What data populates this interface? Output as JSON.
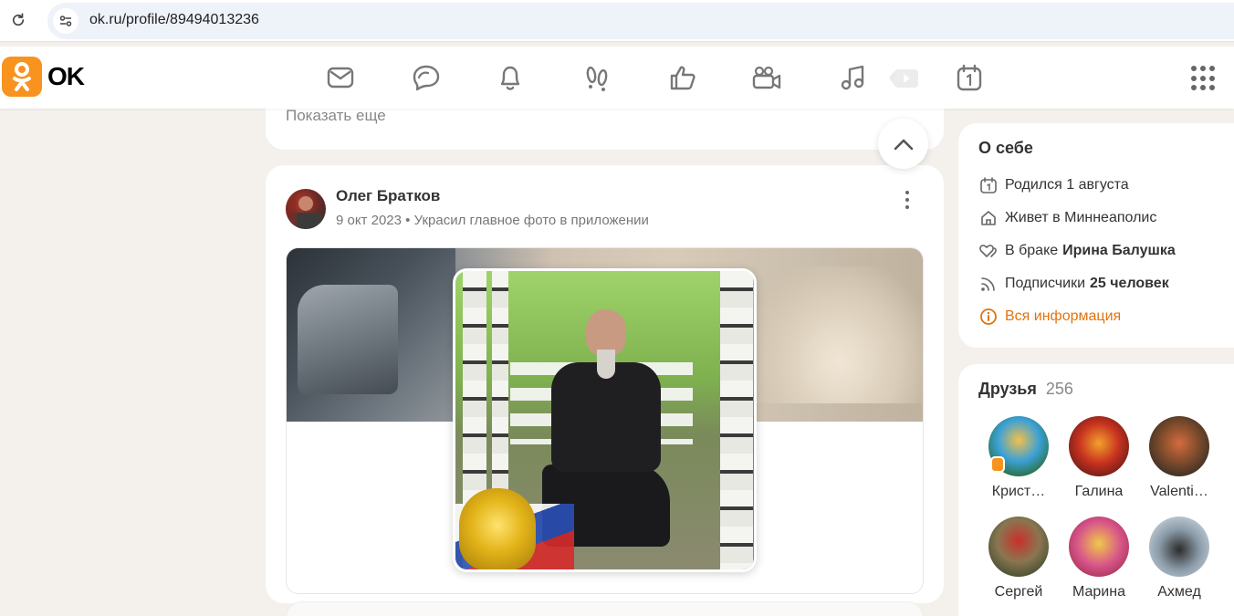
{
  "browser": {
    "url": "ok.ru/profile/89494013236",
    "icons": [
      "reload-icon",
      "site-info-icon"
    ]
  },
  "header": {
    "logo_text": "OK",
    "brand_color": "#f7931e",
    "nav_icons": [
      "messages-icon",
      "discussions-icon",
      "notifications-icon",
      "guests-icon",
      "reactions-icon",
      "video-icon",
      "music-icon",
      "video-play-icon",
      "calendar-icon"
    ],
    "menu_icon": "grid-menu-icon"
  },
  "feed": {
    "show_more": "Показать еще",
    "post": {
      "author": "Олег Братков",
      "date": "9 окт 2023",
      "separator": "•",
      "action": "Украсил главное фото в приложении"
    }
  },
  "about": {
    "title": "О себе",
    "born": "Родился 1 августа",
    "lives": "Живет в Миннеаполис",
    "marriage_prefix": "В браке",
    "marriage_name": "Ирина Балушка",
    "followers_prefix": "Подписчики",
    "followers_count": "25 человек",
    "all_info": "Вся информация",
    "accent_color": "#e0730e"
  },
  "friends": {
    "title": "Друзья",
    "count": "256",
    "items": [
      {
        "name": "Крист…"
      },
      {
        "name": "Галина"
      },
      {
        "name": "Valenti…"
      },
      {
        "name": "Сергей"
      },
      {
        "name": "Марина"
      },
      {
        "name": "Ахмед"
      }
    ]
  }
}
